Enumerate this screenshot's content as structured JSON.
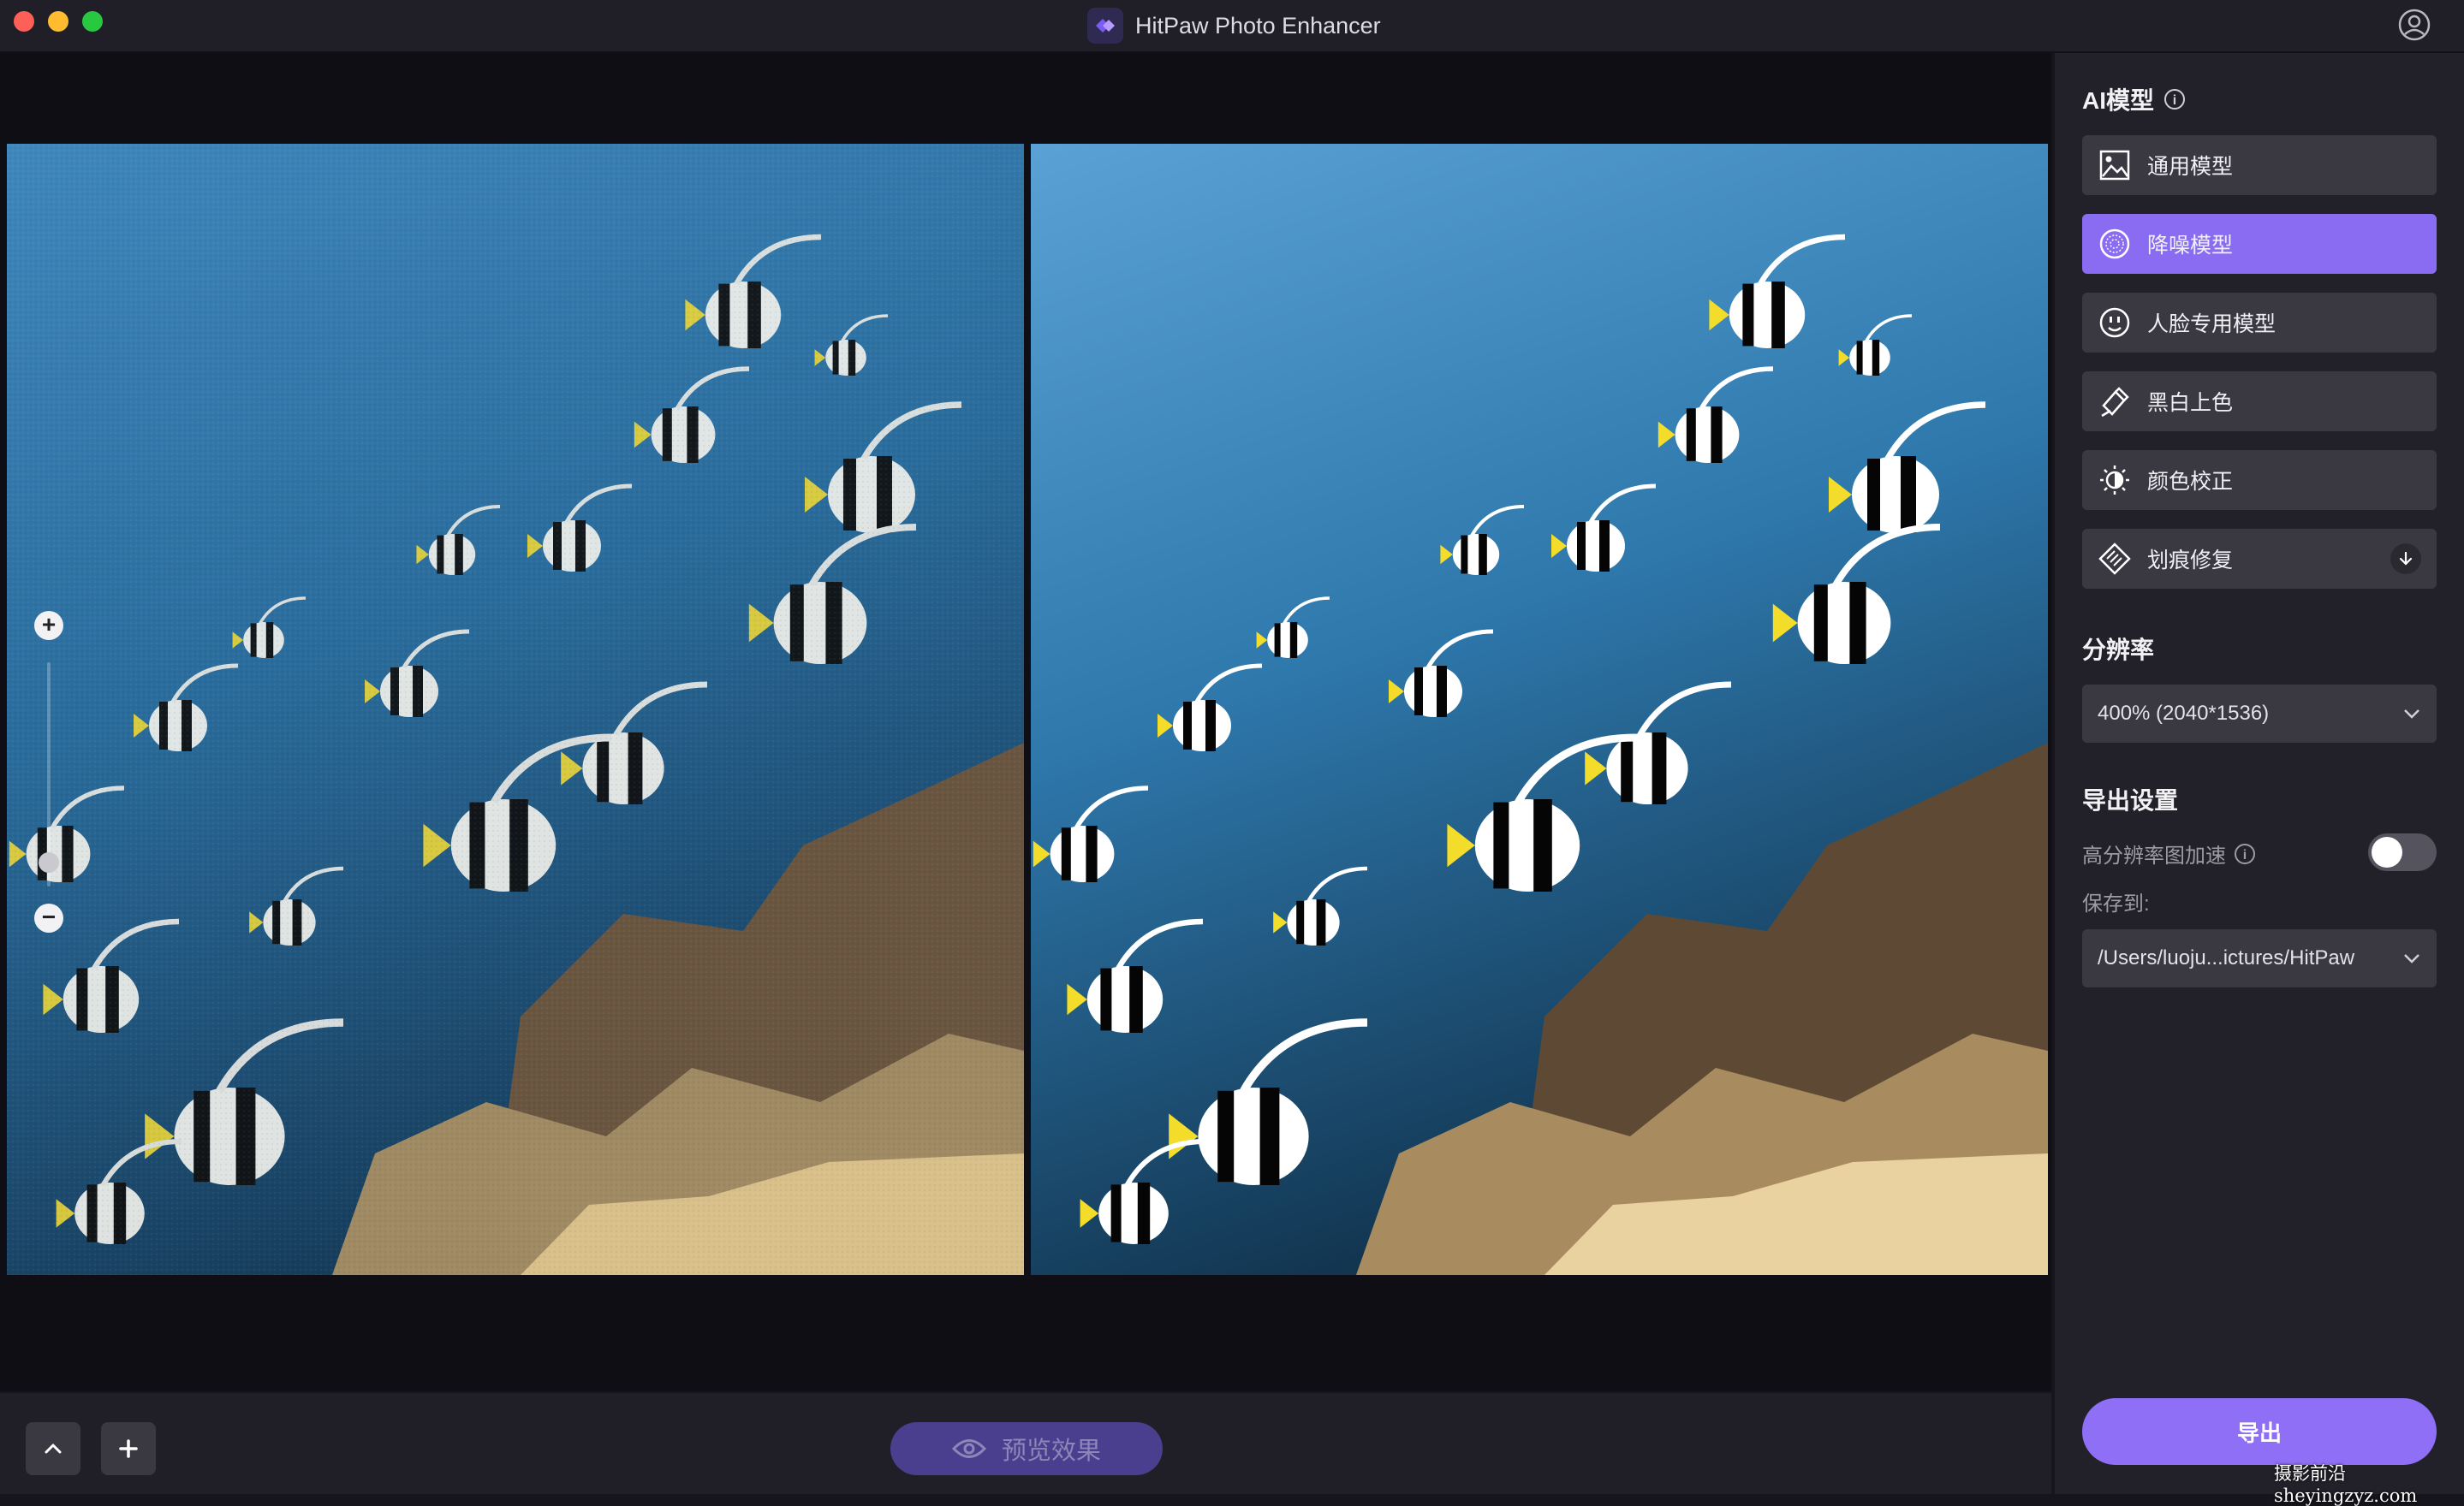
{
  "window": {
    "title": "HitPaw Photo Enhancer"
  },
  "ai_model": {
    "title": "AI模型",
    "items": [
      {
        "label": "通用模型",
        "icon": "image-icon",
        "active": false
      },
      {
        "label": "降噪模型",
        "icon": "denoise-icon",
        "active": true
      },
      {
        "label": "人脸专用模型",
        "icon": "face-icon",
        "active": false
      },
      {
        "label": "黑白上色",
        "icon": "colorize-icon",
        "active": false
      },
      {
        "label": "颜色校正",
        "icon": "color-correct-icon",
        "active": false
      },
      {
        "label": "划痕修复",
        "icon": "scratch-repair-icon",
        "active": false,
        "download": true
      }
    ]
  },
  "resolution": {
    "title": "分辨率",
    "value": "400% (2040*1536)"
  },
  "export_settings": {
    "title": "导出设置",
    "gpu_label": "高分辨率图加速",
    "gpu_enabled": false,
    "save_to_label": "保存到:",
    "save_path": "/Users/luoju...ictures/HitPaw"
  },
  "bottom": {
    "preview_label": "预览效果"
  },
  "export_label": "导出",
  "watermark": "摄影前沿 sheyingzyz.com",
  "colors": {
    "accent": "#8a6cf2",
    "panel": "#22212a",
    "button": "#3a3942"
  }
}
